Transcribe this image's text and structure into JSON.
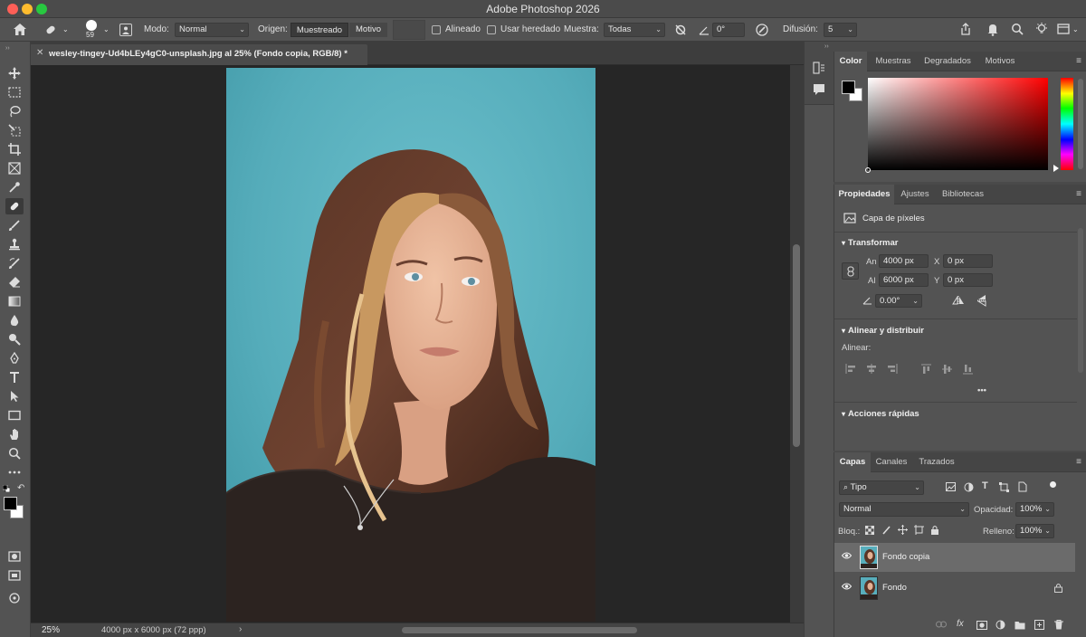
{
  "window": {
    "title": "Adobe Photoshop 2026"
  },
  "options_bar": {
    "brush_size": "59",
    "mode_label": "Modo:",
    "mode_value": "Normal",
    "source_label": "Origen:",
    "source_sampled": "Muestreado",
    "source_pattern": "Motivo",
    "aligned_label": "Alineado",
    "legacy_label": "Usar heredado",
    "sample_label": "Muestra:",
    "sample_value": "Todas",
    "angle_value": "0°",
    "diffusion_label": "Difusión:",
    "diffusion_value": "5"
  },
  "document": {
    "tab_title": "wesley-tingey-Ud4bLEy4gC0-unsplash.jpg al 25% (Fondo copia, RGB/8) *",
    "zoom": "25%",
    "info": "4000 px x 6000 px (72 ppp)"
  },
  "color_panel": {
    "tabs": [
      "Color",
      "Muestras",
      "Degradados",
      "Motivos"
    ],
    "foreground": "#000000",
    "background": "#ffffff",
    "hue": "#ff0000"
  },
  "properties_panel": {
    "tabs": [
      "Propiedades",
      "Ajustes",
      "Bibliotecas"
    ],
    "layer_type": "Capa de píxeles",
    "transform_title": "Transformar",
    "width_label": "An",
    "width_value": "4000 px",
    "height_label": "Al",
    "height_value": "6000 px",
    "x_label": "X",
    "x_value": "0 px",
    "y_label": "Y",
    "y_value": "0 px",
    "angle_value": "0.00°",
    "align_title": "Alinear y distribuir",
    "align_label": "Alinear:",
    "more": "•••",
    "quick_actions_title": "Acciones rápidas"
  },
  "layers_panel": {
    "tabs": [
      "Capas",
      "Canales",
      "Trazados"
    ],
    "filter_value": "Tipo",
    "blend_mode": "Normal",
    "opacity_label": "Opacidad:",
    "opacity_value": "100%",
    "lock_label": "Bloq.:",
    "fill_label": "Relleno:",
    "fill_value": "100%",
    "layers": [
      {
        "name": "Fondo copia",
        "selected": true
      },
      {
        "name": "Fondo",
        "locked": true
      }
    ],
    "footer_fx": "fx"
  }
}
